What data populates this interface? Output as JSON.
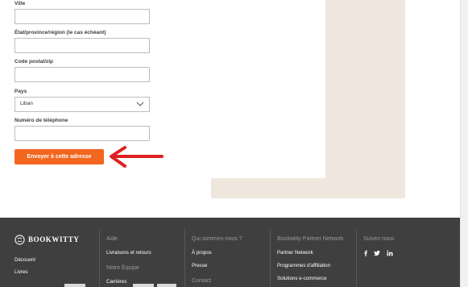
{
  "form": {
    "city_label": "Ville",
    "city_value": "",
    "state_label": "État/province/région (le cas échéant)",
    "state_value": "",
    "zip_label": "Code postal/zip",
    "zip_value": "",
    "country_label": "Pays",
    "country_value": "Liban",
    "phone_label": "Numéro de téléphone",
    "phone_value": "",
    "submit_label": "Envoyer à cette adresse"
  },
  "colors": {
    "accent": "#f2661d",
    "arrow": "#e02020",
    "footer_bg": "#3f3f3f",
    "panel": "#efe7de"
  },
  "footer": {
    "brand": "BOOKWITTY",
    "brand_links": [
      "Découvrir",
      "Livres"
    ],
    "aide": {
      "heading": "Aide",
      "links": [
        "Livraisons et retours"
      ],
      "heading2": "Notre Équipe",
      "links2": [
        "Carrières"
      ]
    },
    "about": {
      "heading": "Qui sommes-nous ?",
      "links": [
        "À propos",
        "Presse",
        "Contact"
      ]
    },
    "partner": {
      "heading": "Bookwitty Partner Network",
      "links": [
        "Partner Network",
        "Programmes d'affiliation",
        "Solutions e-commerce"
      ]
    },
    "follow": {
      "heading": "Suivez-nous",
      "icons": [
        "facebook-icon",
        "twitter-icon",
        "linkedin-icon"
      ]
    }
  }
}
